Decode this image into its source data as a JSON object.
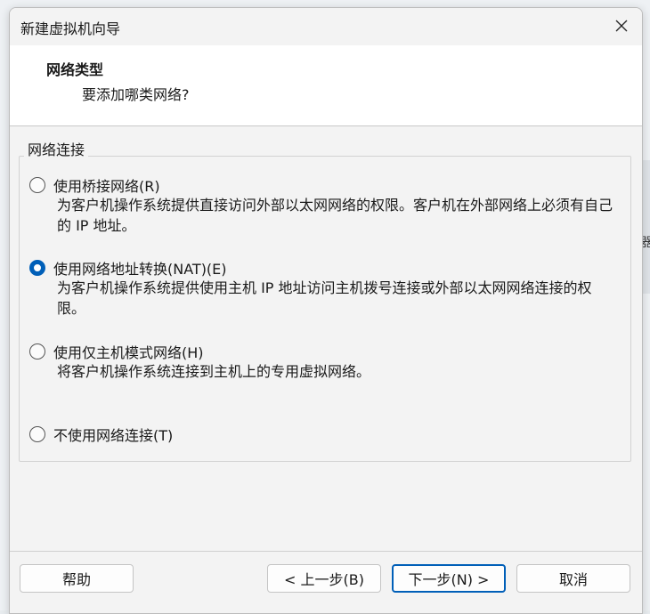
{
  "window": {
    "title": "新建虚拟机向导"
  },
  "header": {
    "title": "网络类型",
    "subtitle": "要添加哪类网络?"
  },
  "group": {
    "label": "网络连接"
  },
  "options": [
    {
      "label": "使用桥接网络(R)",
      "description": "为客户机操作系统提供直接访问外部以太网网络的权限。客户机在外部网络上必须有自己的 IP 地址。",
      "checked": false
    },
    {
      "label": "使用网络地址转换(NAT)(E)",
      "description": "为客户机操作系统提供使用主机 IP 地址访问主机拨号连接或外部以太网网络连接的权限。",
      "checked": true
    },
    {
      "label": "使用仅主机模式网络(H)",
      "description": "将客户机操作系统连接到主机上的专用虚拟网络。",
      "checked": false
    },
    {
      "label": "不使用网络连接(T)",
      "description": "",
      "checked": false
    }
  ],
  "buttons": {
    "help": "帮助",
    "back": "< 上一步(B)",
    "next": "下一步(N) >",
    "cancel": "取消"
  },
  "background": {
    "partial_glyph": "器"
  },
  "colors": {
    "accent": "#005fb8",
    "dialog_bg": "#f3f3f3",
    "header_bg": "#ffffff"
  }
}
